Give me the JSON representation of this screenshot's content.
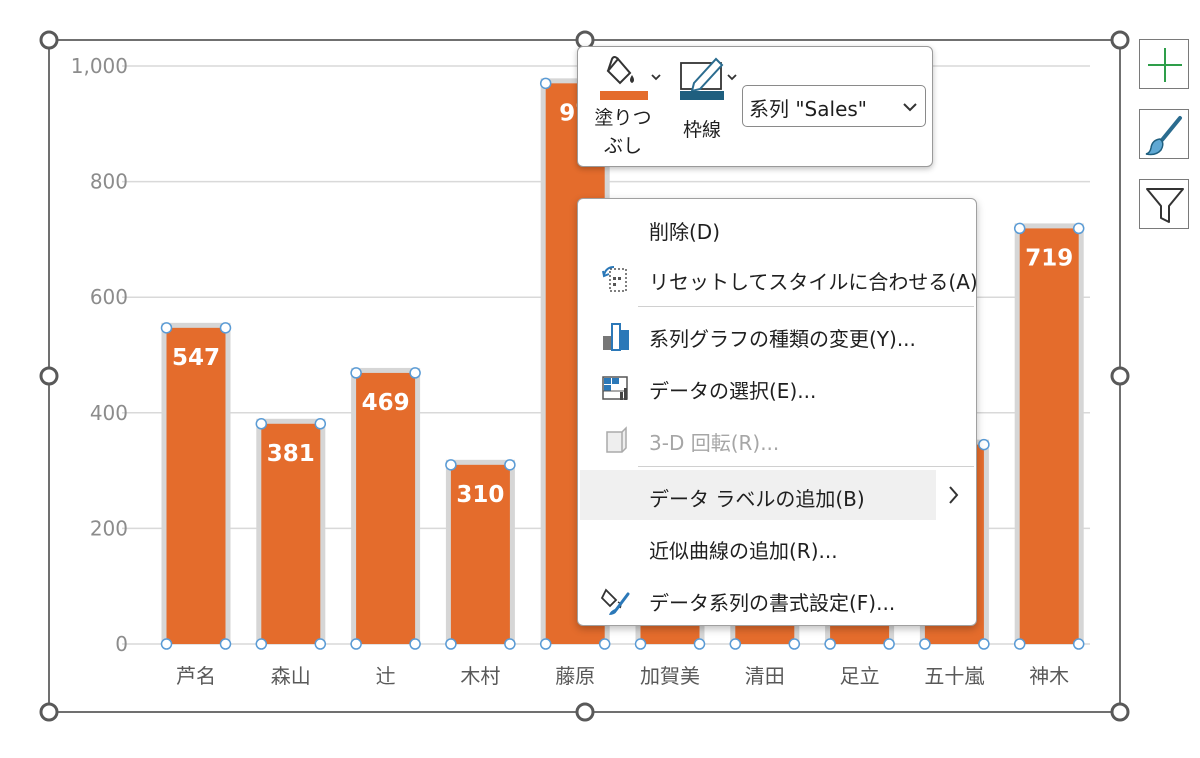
{
  "chart_data": {
    "type": "bar",
    "categories": [
      "芦名",
      "森山",
      "辻",
      "木村",
      "藤原",
      "加賀美",
      "清田",
      "足立",
      "五十嵐",
      "神木"
    ],
    "series": [
      {
        "name": "Sales",
        "values": [
          547,
          381,
          469,
          310,
          970,
          340,
          320,
          330,
          345,
          719
        ],
        "color": "#E46C2C"
      }
    ],
    "data_labels": [
      "547",
      "381",
      "469",
      "310",
      "97",
      "",
      "",
      "",
      "",
      "719"
    ],
    "ylim": [
      0,
      1000
    ],
    "yticks": [
      0,
      200,
      400,
      600,
      800,
      1000
    ],
    "ytick_labels": [
      "0",
      "200",
      "400",
      "600",
      "800",
      "1,000"
    ],
    "grid": true,
    "selected": true
  },
  "colors": {
    "bar": "#E46C2C",
    "bar_shadow": "#d6d6d6",
    "grid": "#d9d9d9",
    "handle": "#5a9bd5",
    "frame": "#404040",
    "accent_green": "#2e9e4a",
    "outline_blue": "#1f5f7f"
  },
  "side_buttons": {
    "add_element_icon": "plus-icon",
    "styles_icon": "brush-icon",
    "filters_icon": "funnel-icon"
  },
  "mini_toolbar": {
    "fill_label_1": "塗りつ",
    "fill_label_2": "ぶし",
    "outline_label": "枠線",
    "series_select_value": "系列 \"Sales\""
  },
  "context_menu": {
    "items": [
      {
        "label": "削除(D)",
        "icon": "none",
        "enabled": true
      },
      {
        "label": "リセットしてスタイルに合わせる(A)",
        "icon": "reset-style-icon",
        "enabled": true
      },
      {
        "label": "系列グラフの種類の変更(Y)...",
        "icon": "change-chart-type-icon",
        "enabled": true
      },
      {
        "label": "データの選択(E)...",
        "icon": "select-data-icon",
        "enabled": true
      },
      {
        "label": "3-D 回転(R)...",
        "icon": "3d-rotation-icon",
        "enabled": false
      },
      {
        "label": "データ ラベルの追加(B)",
        "icon": "none",
        "enabled": true,
        "submenu": true
      },
      {
        "label": "近似曲線の追加(R)...",
        "icon": "none",
        "enabled": true
      },
      {
        "label": "データ系列の書式設定(F)...",
        "icon": "format-series-icon",
        "enabled": true
      }
    ]
  }
}
